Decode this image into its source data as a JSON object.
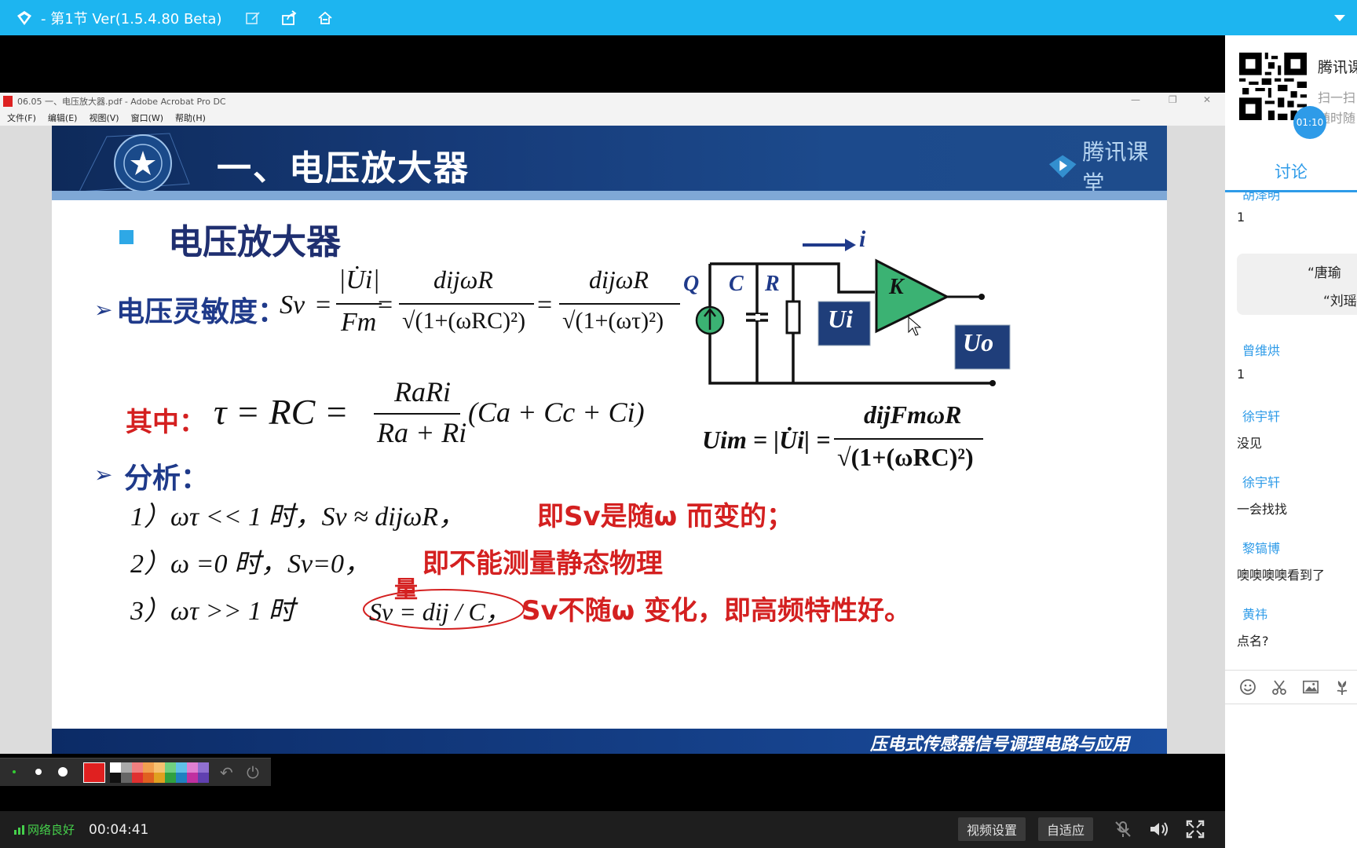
{
  "window": {
    "title": "- 第1节 Ver(1.5.4.80 Beta)"
  },
  "acrobat": {
    "title": "06.05 一、电压放大器.pdf - Adobe Acrobat Pro DC",
    "menu": [
      "文件(F)",
      "编辑(E)",
      "视图(V)",
      "窗口(W)",
      "帮助(H)"
    ]
  },
  "slide": {
    "header_title": "一、电压放大器",
    "watermark": "腾讯课堂",
    "section_title": "电压放大器",
    "sensitivity_label": "电压灵敏度：",
    "sv": "Sv",
    "eq": "=",
    "ui_abs": "|U̇i|",
    "fm": "Fm",
    "num1": "dijωR",
    "den1": "√(1+(ωRC)²)",
    "num2": "dijωR",
    "den2": "√(1+(ωτ)²)",
    "where_label": "其中：",
    "tau_expr": "τ = RC =",
    "ra_ri": "RaRi",
    "ra_plus_ri": "Ra + Ri",
    "c_sum": "(Ca + Cc + Ci)",
    "uim_lhs": "Uim = |U̇i| =",
    "uim_num": "dijFmωR",
    "uim_den": "√(1+(ωRC)²)",
    "analysis_label": "分析：",
    "case1_math": "1）ωτ  << 1  时，Sv ≈ dijωR，",
    "case1_red": "即Sv是随ω 而变的；",
    "case2_math": "2）ω =0 时，Sv=0，",
    "case2_red": "即不能测量静态物理",
    "case3_math": "3）ωτ  >> 1  时",
    "case3_expr": "Sv = dij / C，",
    "case3_red": "Sv不随ω 变化，即高频特性好。",
    "handwritten": "量",
    "footer_text": "压电式传感器信号调理电路与应用",
    "circuit": {
      "current_label": "i",
      "q": "Q",
      "c": "C",
      "r": "R",
      "ui": "Ui",
      "k": "K",
      "uo": "Uo"
    }
  },
  "draw_toolbar": {
    "colors": [
      "#e02020",
      "#ffffff",
      "#222222",
      "#888888",
      "#e04040",
      "#f08080",
      "#f0a050",
      "#50c060",
      "#30b0d0",
      "#d050c0",
      "#7050c0"
    ]
  },
  "status": {
    "network": "网络良好",
    "elapsed": "00:04:41",
    "video_settings": "视频设置",
    "adaptive": "自适应"
  },
  "panel": {
    "brand": "腾讯课",
    "scan_hint": "扫一扫",
    "scan_hint2": "随时随",
    "timer": "01:10",
    "tab": "讨论",
    "messages": [
      {
        "name": "胡泽明",
        "text": "1"
      },
      {
        "name": "曾维烘",
        "text": "1"
      },
      {
        "name": "徐宇轩",
        "text": "没见"
      },
      {
        "name": "徐宇轩",
        "text": "一会找找"
      },
      {
        "name": "黎镐博",
        "text": "噢噢噢噢看到了"
      },
      {
        "name": "黄祎",
        "text": "点名?"
      }
    ],
    "notice_line1": "“唐瑜",
    "notice_line2": "“刘瑶"
  }
}
